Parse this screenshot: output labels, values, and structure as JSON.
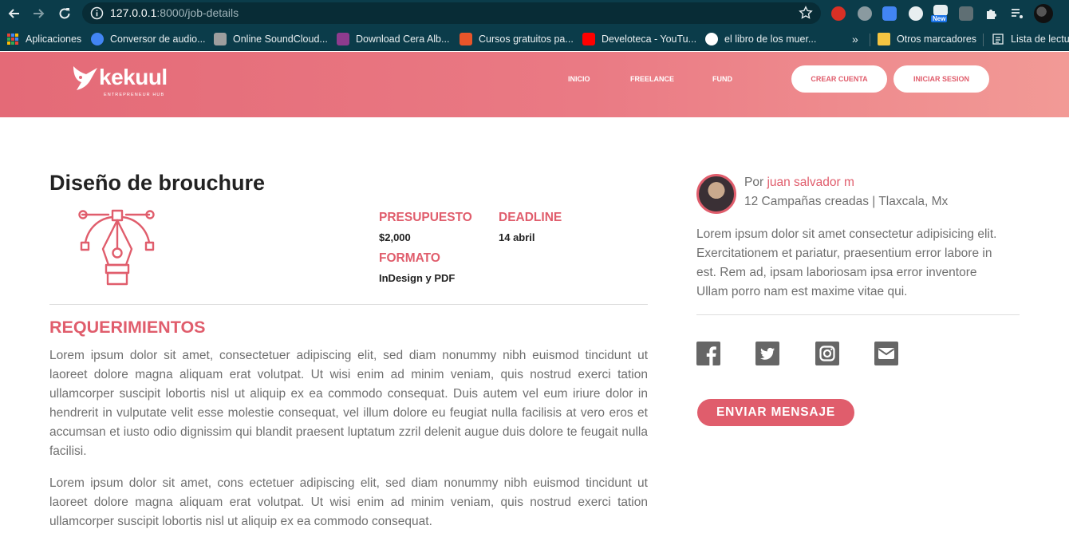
{
  "browser": {
    "url_host": "127.0.0.1",
    "url_rest": ":8000/job-details",
    "extension_badge": "New",
    "bookmarks": [
      {
        "label": "Aplicaciones",
        "color": "#f4b400"
      },
      {
        "label": "Conversor de audio...",
        "color": "#4285f4"
      },
      {
        "label": "Online SoundCloud...",
        "color": "#9e9e9e"
      },
      {
        "label": "Download Cera Alb...",
        "color": "#8e3b8e"
      },
      {
        "label": "Cursos gratuitos pa...",
        "color": "#e8552a"
      },
      {
        "label": "Develoteca - YouTu...",
        "color": "#ff0000"
      },
      {
        "label": "el libro de los muer...",
        "color": "#ffffff"
      }
    ],
    "overflow_label": "»",
    "other_bookmarks": "Otros marcadores",
    "reading_list": "Lista de lectura"
  },
  "site": {
    "logo_text": "kekuul",
    "logo_tagline": "ENTREPRENEUR HUB",
    "nav": [
      "INICIO",
      "FREELANCE",
      "FUND"
    ],
    "create_account": "CREAR CUENTA",
    "login": "INICIAR SESION",
    "brand_color": "#e05d6c"
  },
  "job": {
    "title": "Diseño de brouchure",
    "budget_label": "PRESUPUESTO",
    "budget_value": "$2,000",
    "deadline_label": "DEADLINE",
    "deadline_value": "14 abril",
    "format_label": "FORMATO",
    "format_value": "InDesign y PDF",
    "requirements_heading": "REQUERIMIENTOS",
    "paragraph_1": "Lorem ipsum dolor sit amet, consectetuer adipiscing elit, sed diam nonummy nibh euismod tincidunt ut laoreet dolore magna aliquam erat volutpat. Ut wisi enim ad minim veniam, quis nostrud exerci tation ullamcorper suscipit lobortis nisl ut aliquip ex ea commodo consequat. Duis autem vel eum iriure dolor in hendrerit in vulputate velit esse molestie consequat, vel illum dolore eu feugiat nulla facilisis at vero eros et accumsan et iusto odio dignissim qui blandit praesent luptatum zzril delenit augue duis dolore te feugait nulla facilisi.",
    "paragraph_2": "Lorem ipsum dolor sit amet, cons ectetuer adipiscing elit, sed diam nonummy nibh euismod tincidunt ut laoreet dolore magna aliquam erat volutpat. Ut wisi enim ad minim veniam, quis nostrud exerci tation ullamcorper suscipit lobortis nisl ut aliquip ex ea commodo consequat."
  },
  "author": {
    "by_prefix": "Por",
    "name": "juan salvador m",
    "campaigns": "12 Campañas creadas | Tlaxcala, Mx",
    "bio": "Lorem ipsum dolor sit amet consectetur adipisicing elit. Exercitationem et pariatur, praesentium error labore in est. Rem ad, ipsam laboriosam ipsa error inventore Ullam porro nam est maxime vitae qui.",
    "social_icons": [
      "facebook-icon",
      "twitter-icon",
      "instagram-icon",
      "email-icon"
    ],
    "send_button": "ENVIAR MENSAJE"
  }
}
